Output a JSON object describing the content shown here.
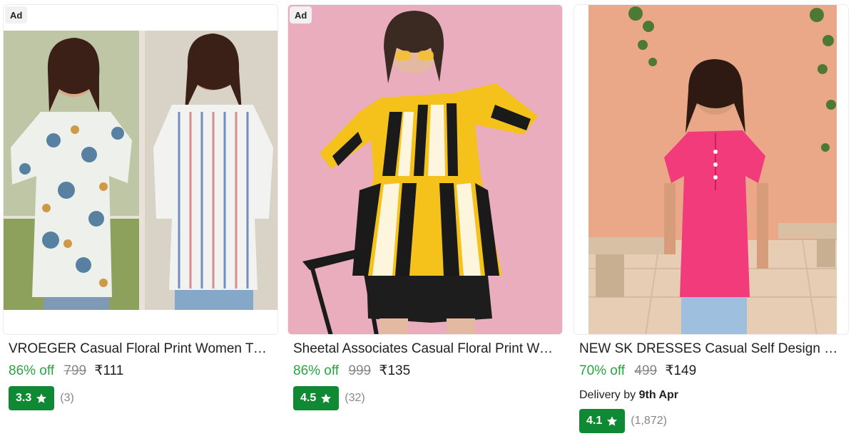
{
  "products": [
    {
      "ad_label": "Ad",
      "title": "VROEGER Casual Floral Print Women Tunic",
      "discount": "86% off",
      "mrp": "799",
      "price": "₹111",
      "rating": "3.3",
      "rating_count": "(3)",
      "colors": {
        "bg": "#e9e4dc",
        "print": "#3f6e94",
        "accent": "#c98a2a"
      }
    },
    {
      "ad_label": "Ad",
      "title": "Sheetal Associates Casual Floral Print Women Top",
      "discount": "86% off",
      "mrp": "999",
      "price": "₹135",
      "rating": "4.5",
      "rating_count": "(32)",
      "colors": {
        "bg": "#e6a4b6",
        "print": "#f4c21a",
        "accent": "#1a1a1a"
      }
    },
    {
      "title": "NEW SK DRESSES Casual Self Design Women Top",
      "discount": "70% off",
      "mrp": "499",
      "price": "₹149",
      "delivery_prefix": "Delivery by",
      "delivery_date": "9th Apr",
      "rating": "4.1",
      "rating_count": "(1,872)",
      "colors": {
        "bg": "#e59a78",
        "print": "#f23b7b",
        "accent": "#9ec0de"
      }
    }
  ],
  "icons": {
    "star": "star-icon"
  },
  "colors": {
    "discount": "#26a541",
    "rating_bg": "#108934",
    "muted": "#878787"
  }
}
